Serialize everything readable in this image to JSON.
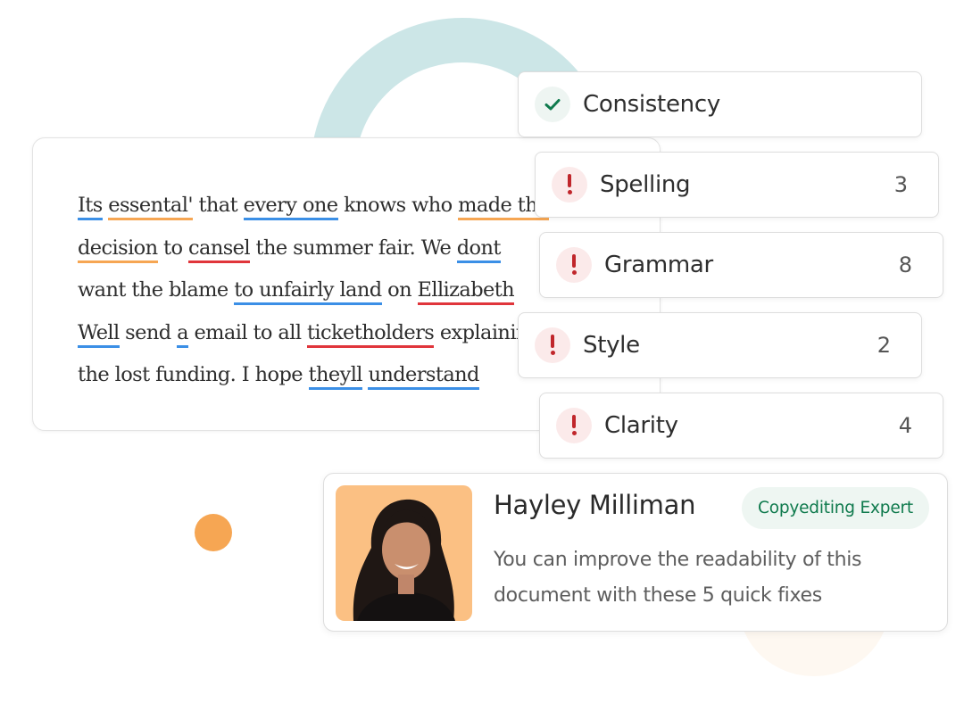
{
  "document": {
    "lines": [
      [
        {
          "t": "Its",
          "u": "blue"
        },
        {
          "t": " "
        },
        {
          "t": "essental'",
          "u": "orange"
        },
        {
          "t": " that "
        },
        {
          "t": "every one",
          "u": "blue"
        },
        {
          "t": " knows who "
        },
        {
          "t": "made the",
          "u": "orange"
        }
      ],
      [
        {
          "t": "decision",
          "u": "orange"
        },
        {
          "t": " to "
        },
        {
          "t": "cansel",
          "u": "red"
        },
        {
          "t": " the summer fair. We "
        },
        {
          "t": "dont",
          "u": "blue"
        }
      ],
      [
        {
          "t": "want the blame "
        },
        {
          "t": "to unfairly land",
          "u": "blue"
        },
        {
          "t": " on "
        },
        {
          "t": "Ellizabeth",
          "u": "red"
        }
      ],
      [
        {
          "t": "Well",
          "u": "blue"
        },
        {
          "t": " send "
        },
        {
          "t": "a",
          "u": "blue"
        },
        {
          "t": " email to all "
        },
        {
          "t": "ticketholders",
          "u": "red"
        },
        {
          "t": " explaining"
        }
      ],
      [
        {
          "t": "the lost funding. I hope "
        },
        {
          "t": "theyll",
          "u": "blue"
        },
        {
          "t": " "
        },
        {
          "t": "understand",
          "u": "blue"
        }
      ]
    ]
  },
  "issues": [
    {
      "label": "Consistency",
      "count": "",
      "status": "ok",
      "icon": "check-icon"
    },
    {
      "label": "Spelling",
      "count": "3",
      "status": "warn",
      "icon": "exclamation-icon"
    },
    {
      "label": "Grammar",
      "count": "8",
      "status": "warn",
      "icon": "exclamation-icon"
    },
    {
      "label": "Style",
      "count": "2",
      "status": "warn",
      "icon": "exclamation-icon"
    },
    {
      "label": "Clarity",
      "count": "4",
      "status": "warn",
      "icon": "exclamation-icon"
    }
  ],
  "expert": {
    "name": "Hayley Milliman",
    "badge": "Copyediting Expert",
    "message": "You can improve the readability of this document with these 5 quick fixes",
    "avatar_icon": "person-photo"
  },
  "colors": {
    "underline_blue": "#3b8fe6",
    "underline_orange": "#f6a653",
    "underline_red": "#e0353b",
    "success_green": "#0f7a4d",
    "error_red": "#c0262b",
    "ring_teal": "#cce6e7",
    "accent_orange": "#f6a653"
  }
}
